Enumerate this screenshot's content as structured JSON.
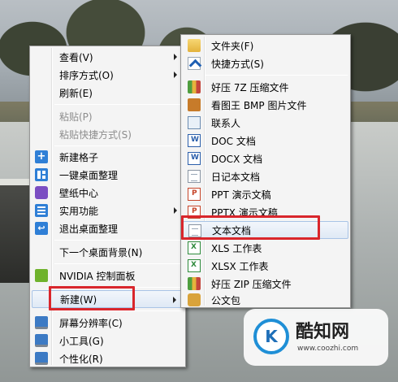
{
  "main_menu": {
    "items": [
      {
        "label": "查看(V)",
        "submenu": true
      },
      {
        "label": "排序方式(O)",
        "submenu": true
      },
      {
        "label": "刷新(E)"
      },
      {
        "label": "粘贴(P)",
        "disabled": true
      },
      {
        "label": "粘贴快捷方式(S)",
        "disabled": true
      },
      {
        "label": "新建格子",
        "icon": "plus-icon"
      },
      {
        "label": "一键桌面整理",
        "icon": "layout-icon"
      },
      {
        "label": "壁纸中心",
        "icon": "cube-icon"
      },
      {
        "label": "实用功能",
        "icon": "list-icon",
        "submenu": true
      },
      {
        "label": "退出桌面整理",
        "icon": "exit-icon"
      },
      {
        "label": "下一个桌面背景(N)"
      },
      {
        "label": "NVIDIA 控制面板",
        "icon": "nvidia-icon"
      },
      {
        "label": "新建(W)",
        "submenu": true,
        "highlighted": true
      },
      {
        "label": "屏幕分辨率(C)",
        "icon": "monitor-icon"
      },
      {
        "label": "小工具(G)",
        "icon": "gadgets-icon"
      },
      {
        "label": "个性化(R)",
        "icon": "personalize-icon"
      }
    ]
  },
  "new_submenu": {
    "items": [
      {
        "label": "文件夹(F)",
        "icon": "folder-icon"
      },
      {
        "label": "快捷方式(S)",
        "icon": "shortcut-icon"
      },
      {
        "label": "好压 7Z 压缩文件",
        "icon": "archive-icon"
      },
      {
        "label": "看图王 BMP 图片文件",
        "icon": "bmp-icon"
      },
      {
        "label": "联系人",
        "icon": "contact-icon"
      },
      {
        "label": "DOC 文档",
        "icon": "word-icon"
      },
      {
        "label": "DOCX 文档",
        "icon": "word-icon"
      },
      {
        "label": "日记本文档",
        "icon": "journal-icon"
      },
      {
        "label": "PPT 演示文稿",
        "icon": "ppt-icon"
      },
      {
        "label": "PPTX 演示文稿",
        "icon": "ppt-icon"
      },
      {
        "label": "文本文档",
        "icon": "text-document-icon",
        "highlighted": true
      },
      {
        "label": "XLS 工作表",
        "icon": "excel-icon"
      },
      {
        "label": "XLSX 工作表",
        "icon": "excel-icon"
      },
      {
        "label": "好压 ZIP 压缩文件",
        "icon": "archive-icon"
      },
      {
        "label": "公文包",
        "icon": "briefcase-icon"
      }
    ]
  },
  "watermark": {
    "logo_glyph": "K",
    "title": "酷知网",
    "url": "www.coozhi.com"
  },
  "colors": {
    "annotation_red": "#d9262c",
    "highlight_border": "#a9c4e6"
  }
}
